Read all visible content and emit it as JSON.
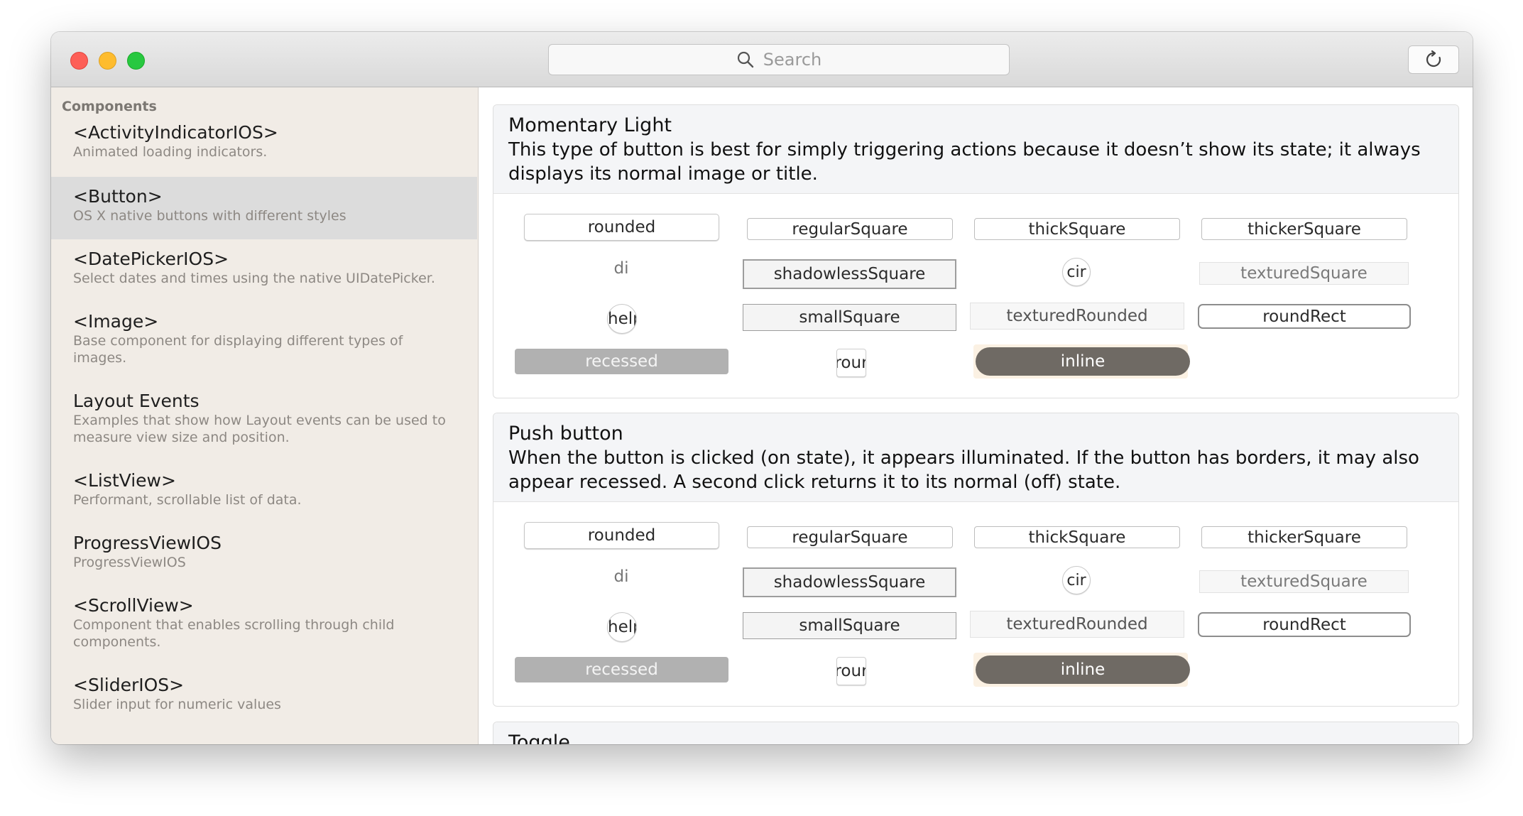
{
  "window": {
    "search": {
      "placeholder": "Search",
      "icon": "search-icon"
    },
    "reload": {
      "icon": "refresh-icon"
    }
  },
  "sidebar": {
    "title": "Components",
    "items": [
      {
        "name": "<ActivityIndicatorIOS>",
        "desc": "Animated loading indicators."
      },
      {
        "name": "<Button>",
        "desc": "OS X native buttons with different styles"
      },
      {
        "name": "<DatePickerIOS>",
        "desc": "Select dates and times using the native UIDatePicker."
      },
      {
        "name": "<Image>",
        "desc": "Base component for displaying different types of images."
      },
      {
        "name": "Layout Events",
        "desc": "Examples that show how Layout events can be used to measure view size and position."
      },
      {
        "name": "<ListView>",
        "desc": "Performant, scrollable list of data."
      },
      {
        "name": "ProgressViewIOS",
        "desc": "ProgressViewIOS"
      },
      {
        "name": "<ScrollView>",
        "desc": "Component that enables scrolling through child components."
      },
      {
        "name": "<SliderIOS>",
        "desc": "Slider input for numeric values"
      }
    ]
  },
  "panels": [
    {
      "title": "Momentary Light",
      "desc": "This type of button is best for simply triggering actions because it doesn’t show its state; it always displays its normal image or title.",
      "buttons": {
        "rounded": "rounded",
        "regularSquare": "regularSquare",
        "thickSquare": "thickSquare",
        "thickerSquare": "thickerSquare",
        "disclosure": "di",
        "shadowlessSquare": "shadowlessSquare",
        "circular": "cir",
        "texturedSquare": "texturedSquare",
        "help": "help",
        "smallSquare": "smallSquare",
        "texturedRounded": "texturedRounded",
        "roundRect": "roundRect",
        "recessed": "recessed",
        "roundedDisclosure": "rour",
        "inline": "inline"
      }
    },
    {
      "title": "Push button",
      "desc": "When the button is clicked (on state), it appears illuminated. If the button has borders, it may also appear recessed. A second click returns it to its normal (off) state.",
      "buttons": {
        "rounded": "rounded",
        "regularSquare": "regularSquare",
        "thickSquare": "thickSquare",
        "thickerSquare": "thickerSquare",
        "disclosure": "di",
        "shadowlessSquare": "shadowlessSquare",
        "circular": "cir",
        "texturedSquare": "texturedSquare",
        "help": "help",
        "smallSquare": "smallSquare",
        "texturedRounded": "texturedRounded",
        "roundRect": "roundRect",
        "recessed": "recessed",
        "roundedDisclosure": "rour",
        "inline": "inline"
      }
    },
    {
      "title": "Toggle"
    }
  ]
}
